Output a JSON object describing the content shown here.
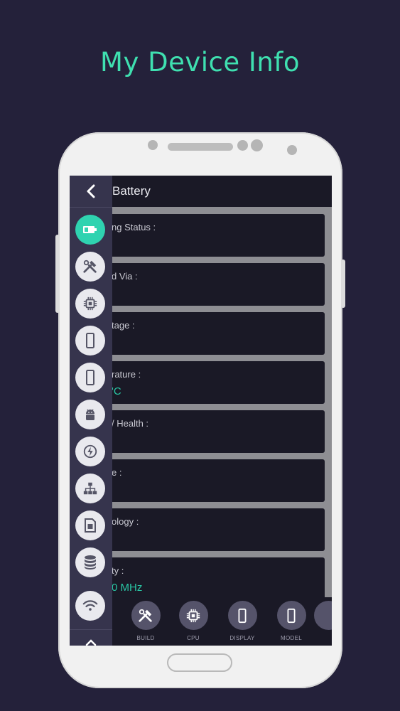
{
  "hero": {
    "title": "My Device Info"
  },
  "screen": {
    "header": {
      "title": "Battery"
    },
    "cards": [
      {
        "label": "ng Status :",
        "value": ""
      },
      {
        "label": "d Via :",
        "value": ""
      },
      {
        "label": "tage :",
        "value": ""
      },
      {
        "label": "rature :",
        "value": "'C"
      },
      {
        "label": "/ Health :",
        "value": ""
      },
      {
        "label": "e :",
        "value": ""
      },
      {
        "label": "ology :",
        "value": ""
      },
      {
        "label": "ty :",
        "value": "0 MHz"
      }
    ],
    "bottom_nav": [
      {
        "label": "BUILD",
        "icon": "tools-icon"
      },
      {
        "label": "CPU",
        "icon": "chip-icon"
      },
      {
        "label": "DISPLAY",
        "icon": "phone-icon"
      },
      {
        "label": "MODEL",
        "icon": "phone-icon"
      }
    ]
  },
  "sidebar": {
    "items": [
      {
        "icon": "battery-icon",
        "active": true
      },
      {
        "icon": "tools-icon"
      },
      {
        "icon": "chip-icon"
      },
      {
        "icon": "phone-icon"
      },
      {
        "icon": "phone-icon"
      },
      {
        "icon": "android-icon"
      },
      {
        "icon": "power-icon"
      },
      {
        "icon": "network-icon"
      },
      {
        "icon": "sim-card-icon"
      },
      {
        "icon": "database-icon"
      },
      {
        "icon": "wifi-icon"
      }
    ]
  },
  "colors": {
    "accent": "#3fe0b0",
    "background": "#24213a",
    "card": "#1a1926",
    "sidebar": "#36344d"
  }
}
